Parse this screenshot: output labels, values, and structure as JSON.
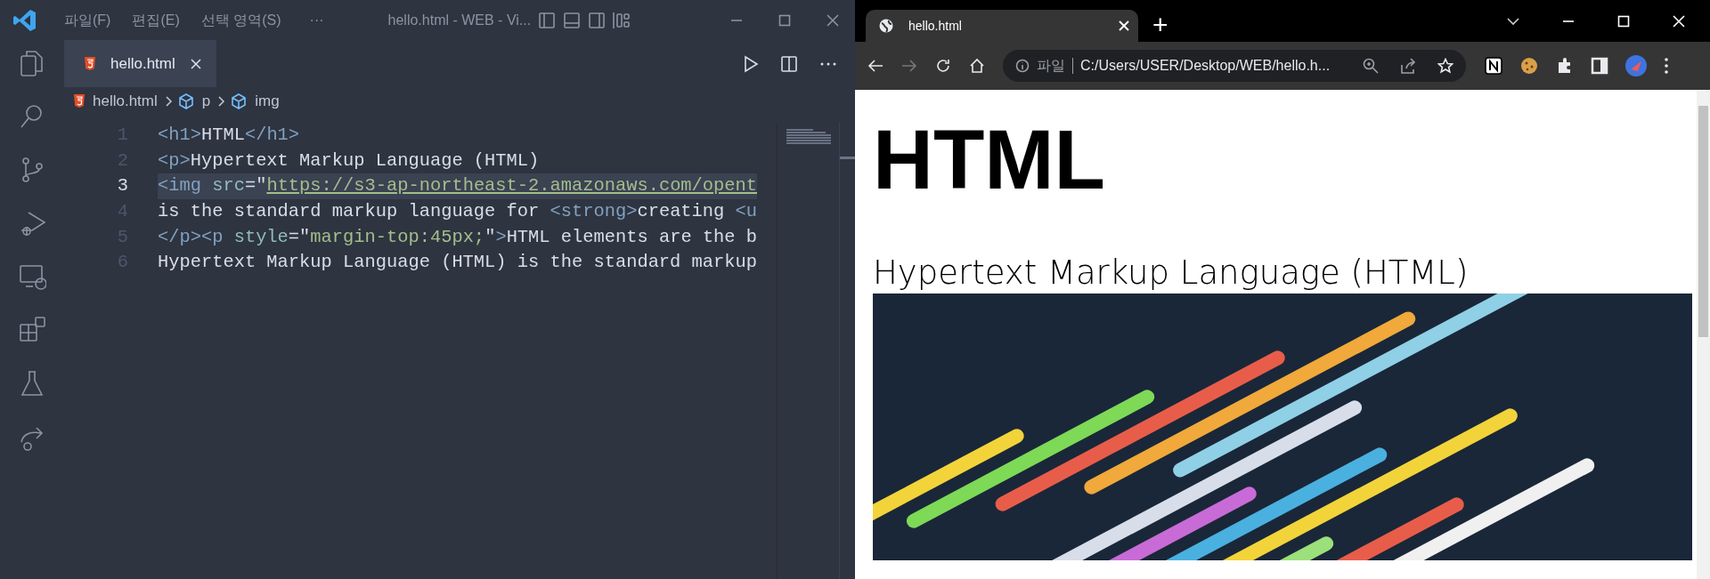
{
  "editor": {
    "menu": [
      "파일(F)",
      "편집(E)",
      "선택 영역(S)"
    ],
    "menu_more": "···",
    "title": "hello.html - WEB - Vi...",
    "tabs": [
      {
        "label": "hello.html",
        "selected": true
      }
    ],
    "breadcrumbs": [
      {
        "kind": "file",
        "label": "hello.html"
      },
      {
        "kind": "element",
        "label": "p"
      },
      {
        "kind": "element",
        "label": "img"
      }
    ],
    "lines": [
      {
        "number": "1",
        "current": false,
        "tokens": [
          {
            "kind": "tag",
            "text": "<h1>"
          },
          {
            "kind": "text",
            "text": "HTML"
          },
          {
            "kind": "tag",
            "text": "</h1>"
          }
        ]
      },
      {
        "number": "2",
        "current": false,
        "tokens": [
          {
            "kind": "tag",
            "text": "<p>"
          },
          {
            "kind": "text",
            "text": "Hypertext Markup Language (HTML)"
          }
        ]
      },
      {
        "number": "3",
        "current": true,
        "tokens": [
          {
            "kind": "tag",
            "text": "<img "
          },
          {
            "kind": "attr",
            "text": "src"
          },
          {
            "kind": "text",
            "text": "=\""
          },
          {
            "kind": "link",
            "text": "https://s3-ap-northeast-2.amazonaws.com/opent"
          }
        ]
      },
      {
        "number": "4",
        "current": false,
        "tokens": [
          {
            "kind": "text",
            "text": "is the standard markup language for "
          },
          {
            "kind": "tag",
            "text": "<strong>"
          },
          {
            "kind": "text",
            "text": "creating "
          },
          {
            "kind": "tag",
            "text": "<u"
          }
        ]
      },
      {
        "number": "5",
        "current": false,
        "tokens": [
          {
            "kind": "tag",
            "text": "</p><p "
          },
          {
            "kind": "attr",
            "text": "style"
          },
          {
            "kind": "text",
            "text": "=\""
          },
          {
            "kind": "string",
            "text": "margin-top:45px;"
          },
          {
            "kind": "text",
            "text": "\""
          },
          {
            "kind": "tag",
            "text": ">"
          },
          {
            "kind": "text",
            "text": "HTML elements are the b"
          }
        ]
      },
      {
        "number": "6",
        "current": false,
        "tokens": [
          {
            "kind": "text",
            "text": "Hypertext Markup Language (HTML) is the standard markup"
          }
        ]
      }
    ]
  },
  "browser": {
    "tabs": [
      {
        "title": "hello.html",
        "selected": true
      }
    ],
    "new_tab": "+",
    "address": {
      "scheme": "파일",
      "url": "C:/Users/USER/Desktop/WEB/hello.h..."
    },
    "page": {
      "heading": "HTML",
      "paragraph": "Hypertext Markup Language (HTML)"
    }
  }
}
